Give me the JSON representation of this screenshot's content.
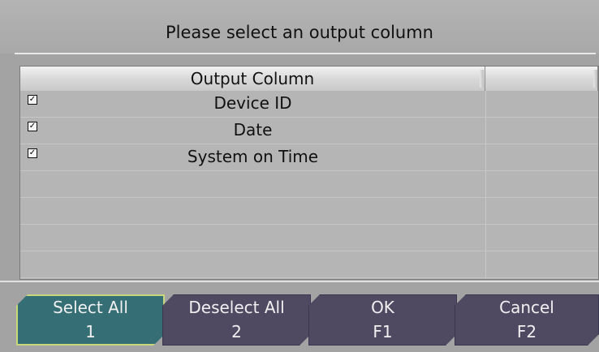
{
  "dialog": {
    "title": "Please select an output column"
  },
  "table": {
    "header": {
      "col1": "Output Column",
      "col2": ""
    },
    "rows": [
      {
        "label": "Device ID",
        "checked": true
      },
      {
        "label": "Date",
        "checked": true
      },
      {
        "label": "System on Time",
        "checked": true
      },
      {
        "label": "",
        "checked": false
      },
      {
        "label": "",
        "checked": false
      },
      {
        "label": "",
        "checked": false
      },
      {
        "label": "",
        "checked": false
      }
    ]
  },
  "buttons": [
    {
      "label": "Select All",
      "key": "1"
    },
    {
      "label": "Deselect All",
      "key": "2"
    },
    {
      "label": "OK",
      "key": "F1"
    },
    {
      "label": "Cancel",
      "key": "F2"
    }
  ],
  "colors": {
    "primary_button": "#356e74",
    "normal_button": "#4f4a62",
    "background": "#a3a3a3"
  }
}
